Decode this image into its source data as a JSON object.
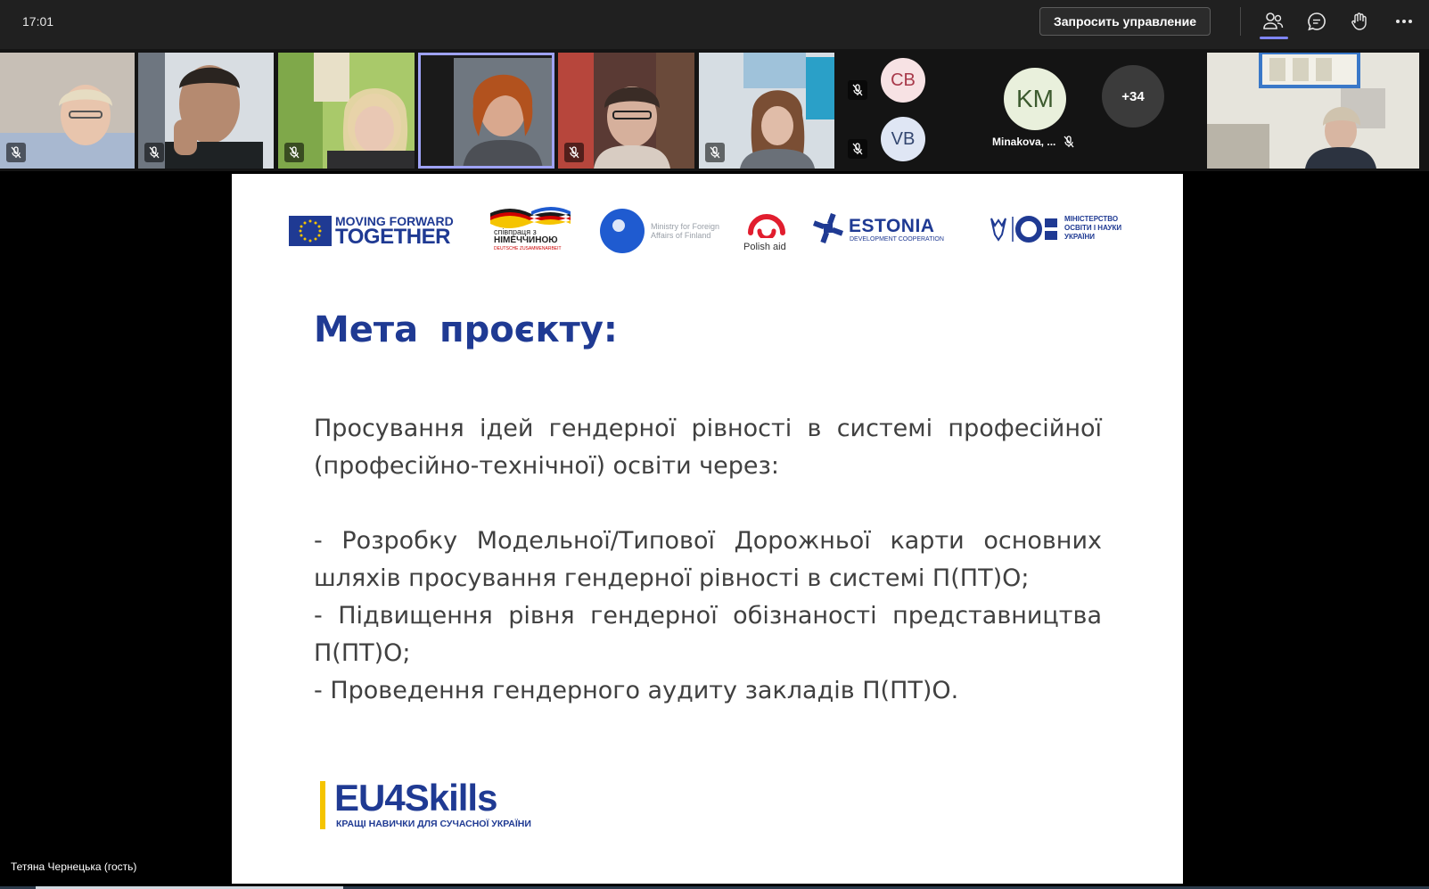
{
  "topbar": {
    "time": "17:01",
    "request_control_label": "Запросить управление",
    "icons": [
      "people-icon",
      "chat-icon",
      "raise-hand-icon",
      "more-icon"
    ]
  },
  "participants": {
    "avatars": [
      {
        "initials": "CB",
        "bg": "#f7e2e4",
        "fg": "#a8394a"
      },
      {
        "initials": "VB",
        "bg": "#dfe6f4",
        "fg": "#33466f"
      }
    ],
    "large_avatar": {
      "initials": "KM",
      "name": "Minakova, ..."
    },
    "more_count": "+34"
  },
  "slide": {
    "logos": {
      "eu_text_line1": "MOVING FORWARD",
      "eu_text_line2": "TOGETHER",
      "germany_line1": "співпраця з",
      "germany_line2": "НІМЕЧЧИНОЮ",
      "germany_line3": "DEUTSCHE ZUSAMMENARBEIT",
      "finland_line1": "Ministry for Foreign",
      "finland_line2": "Affairs of Finland",
      "polish": "Polish aid",
      "estonia_line1": "ESTONIA",
      "estonia_line2": "DEVELOPMENT COOPERATION",
      "ministry_line1": "МІНІСТЕРСТВО",
      "ministry_line2": "ОСВІТИ І НАУКИ",
      "ministry_line3": "УКРАЇНИ"
    },
    "title": "Мета проєкту:",
    "intro": "Просування ідей гендерної рівності в системі професійної (професійно-технічної) освіти через:",
    "bullets": [
      "- Розробку Модельної/Типової Дорожньої карти основних шляхів просування гендерної рівності в системі П(ПТ)О;",
      "- Підвищення рівня гендерної обізнаності представництва П(ПТ)О;",
      "- Проведення гендерного аудиту закладів П(ПТ)О."
    ],
    "footer_logo": {
      "main": "EU4Skills",
      "sub": "КРАЩІ НАВИЧКИ ДЛЯ СУЧАСНОЇ УКРАЇНИ"
    }
  },
  "presenter_name": "Тетяна Чернецька (гость)",
  "colors": {
    "accent": "#7f85f5",
    "slide_title": "#1f3a93",
    "app_bg": "#202020"
  }
}
